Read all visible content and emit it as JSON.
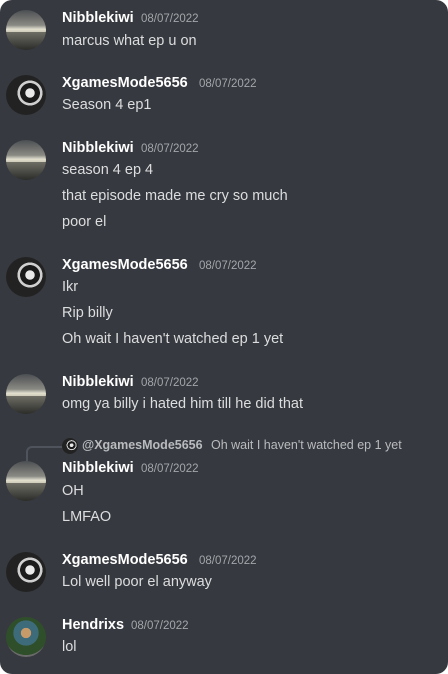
{
  "messages": [
    {
      "author": "Nibblekiwi",
      "time": "08/07/2022",
      "lines": [
        "marcus what ep u on"
      ]
    },
    {
      "author": "XgamesMode5656",
      "time": "08/07/2022",
      "lines": [
        "Season 4 ep1"
      ]
    },
    {
      "author": "Nibblekiwi",
      "time": "08/07/2022",
      "lines": [
        "season 4 ep 4",
        "that episode made me cry so much",
        "poor el"
      ]
    },
    {
      "author": "XgamesMode5656",
      "time": "08/07/2022",
      "lines": [
        "Ikr",
        "Rip billy",
        "Oh wait I haven't watched ep 1 yet"
      ]
    },
    {
      "author": "Nibblekiwi",
      "time": "08/07/2022",
      "lines": [
        "omg ya billy i hated him till he did that"
      ]
    },
    {
      "author": "Nibblekiwi",
      "time": "08/07/2022",
      "reply": {
        "author": "@XgamesMode5656",
        "text": "Oh wait I haven't watched ep 1 yet"
      },
      "lines": [
        "OH",
        "LMFAO"
      ]
    },
    {
      "author": "XgamesMode5656",
      "time": "08/07/2022",
      "lines": [
        "Lol well poor el anyway"
      ]
    },
    {
      "author": "Hendrixs",
      "time": "08/07/2022",
      "lines": [
        "lol"
      ]
    }
  ]
}
